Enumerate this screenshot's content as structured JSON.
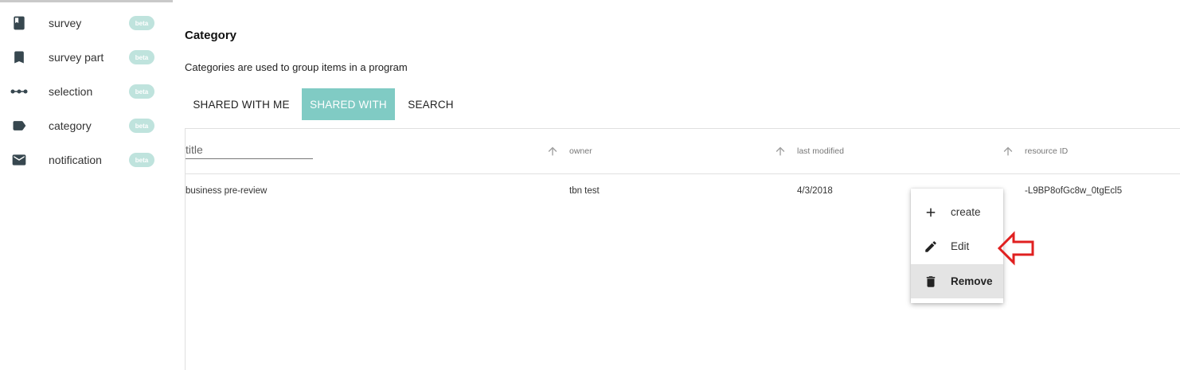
{
  "sidebar": {
    "items": [
      {
        "label": "survey",
        "icon": "book-icon",
        "badge": "beta"
      },
      {
        "label": "survey part",
        "icon": "bookmark-icon",
        "badge": "beta"
      },
      {
        "label": "selection",
        "icon": "dots-line-icon",
        "badge": "beta"
      },
      {
        "label": "category",
        "icon": "label-tag-icon",
        "badge": "beta"
      },
      {
        "label": "notification",
        "icon": "mail-icon",
        "badge": "beta"
      }
    ]
  },
  "main": {
    "title": "Category",
    "description": "Categories are used to group items in a program",
    "tabs": [
      {
        "label": "SHARED WITH ME",
        "active": false
      },
      {
        "label": "SHARED WITH",
        "active": true
      },
      {
        "label": "SEARCH",
        "active": false
      }
    ]
  },
  "table": {
    "title_filter_placeholder": "title",
    "columns": [
      "owner",
      "last modified",
      "resource ID"
    ],
    "rows": [
      {
        "title": "business pre-review",
        "owner": "tbn test",
        "last_modified": "4/3/2018",
        "resource_id": "-L9BP8ofGc8w_0tgEcl5"
      }
    ]
  },
  "context_menu": {
    "items": [
      {
        "label": "create",
        "icon": "plus-icon"
      },
      {
        "label": "Edit",
        "icon": "pencil-icon"
      },
      {
        "label": "Remove",
        "icon": "trash-icon",
        "highlighted": true
      }
    ]
  },
  "colors": {
    "accent": "#80cbc4",
    "badge": "#bfe3dd",
    "annotation": "#e02020"
  }
}
